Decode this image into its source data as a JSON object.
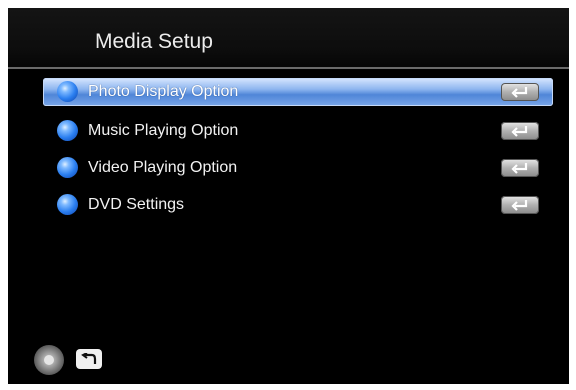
{
  "screen": {
    "title": "Media Setup",
    "menu": [
      {
        "label": "Photo Display Option",
        "selected": true,
        "icon": "globe-icon",
        "action_icon": "enter-key-icon"
      },
      {
        "label": "Music Playing Option",
        "selected": false,
        "icon": "globe-icon",
        "action_icon": "enter-key-icon"
      },
      {
        "label": "Video Playing Option",
        "selected": false,
        "icon": "globe-icon",
        "action_icon": "enter-key-icon"
      },
      {
        "label": "DVD Settings",
        "selected": false,
        "icon": "globe-icon",
        "action_icon": "enter-key-icon"
      }
    ]
  },
  "footer": {
    "icons": [
      "dpad-icon",
      "back-icon"
    ]
  },
  "colors": {
    "background": "#000000",
    "selection": "#5a8fde",
    "text": "#f2f2f2"
  }
}
